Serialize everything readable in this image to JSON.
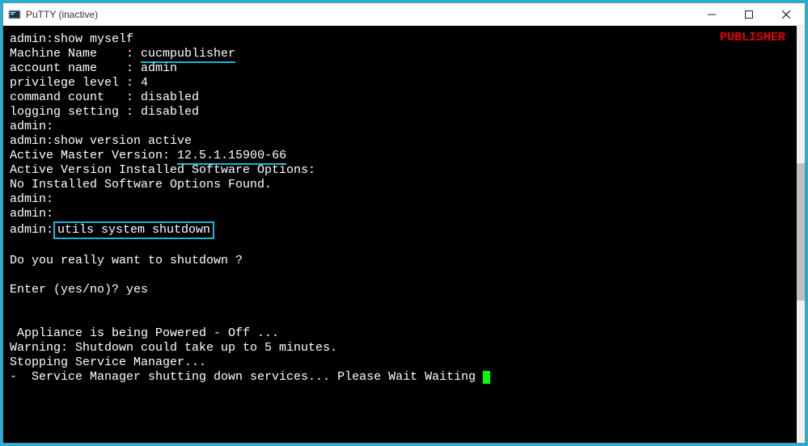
{
  "window": {
    "title": "PuTTY (inactive)"
  },
  "overlay": {
    "publisher_label": "PUBLISHER"
  },
  "terminal": {
    "prompt": "admin:",
    "cmd_show_myself": "show myself",
    "machine_name_label": "Machine Name    : ",
    "machine_name_value": "cucmpublisher",
    "account_name_line": "account name    : admin",
    "privilege_line": "privilege level : 4",
    "command_count_line": "command count   : disabled",
    "logging_line": "logging setting : disabled",
    "cmd_show_version": "show version active",
    "active_master_label": "Active Master Version: ",
    "active_master_value": "12.5.1.15900-66",
    "installed_options_header": "Active Version Installed Software Options:",
    "installed_options_none": "No Installed Software Options Found.",
    "cmd_shutdown": "utils system shutdown",
    "confirm_q": "Do you really want to shutdown ?",
    "confirm_prompt": "Enter (yes/no)? yes",
    "powering_off": " Appliance is being Powered - Off ...",
    "warning": "Warning: Shutdown could take up to 5 minutes.",
    "stopping": "Stopping Service Manager...",
    "shutting_down": "-  Service Manager shutting down services... Please Wait Waiting "
  }
}
